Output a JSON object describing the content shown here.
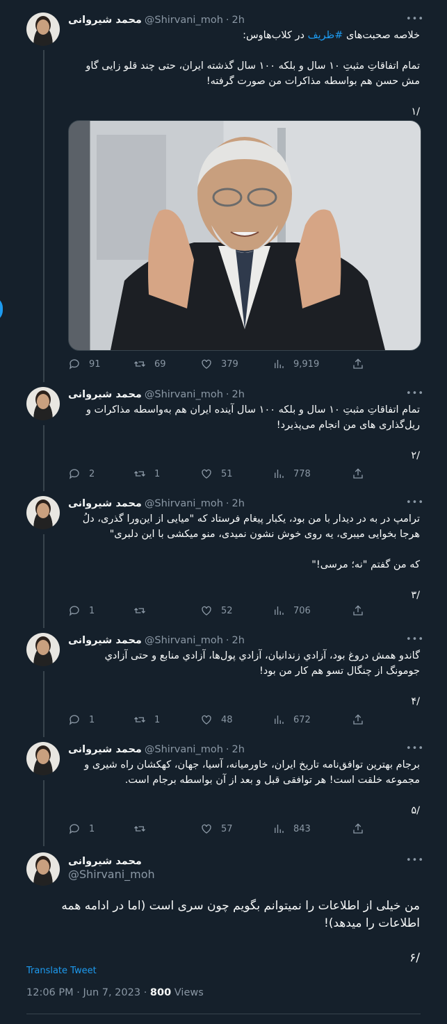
{
  "thread": [
    {
      "name": "محمد شیروانی",
      "handle": "@Shirvani_moh",
      "time": "2h",
      "text_pre": "خلاصه صحبت‌های ",
      "hashtag": "#ظریف",
      "text_post": " در کلاب‌هاوس:\n\nتمام اتفاقاتِ مثبتِ ۱۰ سال و بلکه ۱۰۰ سال گذشته ایران، حتی چند قلو زایی گاو مش حسن هم بواسطه مذاکرات من صورت گرفته!\n\n/۱",
      "stats": {
        "replies": "91",
        "retweets": "69",
        "likes": "379",
        "views": "9,919"
      }
    },
    {
      "name": "محمد شیروانی",
      "handle": "@Shirvani_moh",
      "time": "2h",
      "text": "تمام اتفاقاتِ مثبتِ ۱۰ سال و بلکه ۱۰۰ سال آینده ایران هم به‌واسطه مذاکرات و ریل‌گذاری های من انجام می‌پذیرد!\n\n/۲",
      "stats": {
        "replies": "2",
        "retweets": "1",
        "likes": "51",
        "views": "778"
      }
    },
    {
      "name": "محمد شیروانی",
      "handle": "@Shirvani_moh",
      "time": "2h",
      "text": "ترامپ در به در دیدار با من بود، یکبار پیغام فرستاد که \"میایی از این‌ورا گذری، دلُ هرجا بخوایی میبری، یه روی خوش نشون نمیدی، منو میکشی با این دلبری\"\n\nکه من گفتم \"نه؛ مرسی!\"\n\n/۳",
      "stats": {
        "replies": "1",
        "retweets": "",
        "likes": "52",
        "views": "706"
      }
    },
    {
      "name": "محمد شیروانی",
      "handle": "@Shirvani_moh",
      "time": "2h",
      "text": "گاندو همش دروغ بود، آزادي زندانیان، آزادي پول‌ها، آزادي منابع و حتی آزادي جومونگ از چنگال تسو هم کار من بود!\n\n/۴",
      "stats": {
        "replies": "1",
        "retweets": "1",
        "likes": "48",
        "views": "672"
      }
    },
    {
      "name": "محمد شیروانی",
      "handle": "@Shirvani_moh",
      "time": "2h",
      "text": "برجام بهترین توافق‌نامه تاریخ ایران، خاورمیانه، آسیا، جهان، کهکشان راه شیری و مجموعه خلقت است! هر توافقی قبل و بعد از آن بواسطه برجام است.\n\n/۵",
      "stats": {
        "replies": "1",
        "retweets": "",
        "likes": "57",
        "views": "843"
      }
    }
  ],
  "main_tweet": {
    "name": "محمد شیروانی",
    "handle": "@Shirvani_moh",
    "text": "من خیلی از اطلاعات را نمیتوانم بگویم چون سری است (اما در ادامه همه اطلاعات را میدهد)!\n\n/۶",
    "translate_label": "Translate Tweet",
    "time": "12:06 PM · Jun 7, 2023 · ",
    "views_count": "800",
    "views_label": " Views"
  },
  "icons": [
    "more-icon",
    "reply-icon",
    "retweet-icon",
    "like-icon",
    "views-icon",
    "share-icon"
  ],
  "colors": {
    "background": "#15202b",
    "accent": "#1d9bf0",
    "muted": "#8b98a5",
    "divider": "#38444d"
  }
}
